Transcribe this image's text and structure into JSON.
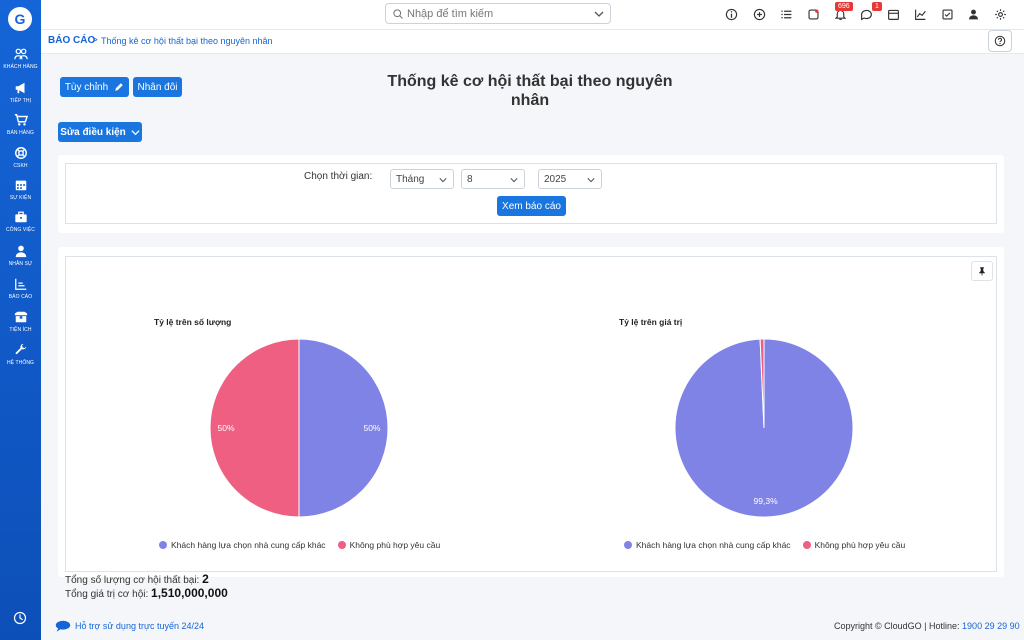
{
  "sidebar": {
    "logo": "G",
    "items": [
      {
        "label": "KHÁCH HÀNG",
        "icon": "users-icon"
      },
      {
        "label": "TIẾP THỊ",
        "icon": "megaphone-icon"
      },
      {
        "label": "BÁN HÀNG",
        "icon": "cart-icon"
      },
      {
        "label": "CSKH",
        "icon": "lifebuoy-icon"
      },
      {
        "label": "SỰ KIỆN",
        "icon": "calendar-icon"
      },
      {
        "label": "CÔNG VIỆC",
        "icon": "briefcase-icon"
      },
      {
        "label": "NHÂN SỰ",
        "icon": "person-icon"
      },
      {
        "label": "BÁO CÁO",
        "icon": "report-icon"
      },
      {
        "label": "TIỆN ÍCH",
        "icon": "box-icon"
      },
      {
        "label": "HỆ THỐNG",
        "icon": "wrench-icon"
      }
    ]
  },
  "topbar": {
    "search_placeholder": "Nhập để tìm kiếm",
    "notification_count": "696",
    "message_count": "1"
  },
  "breadcrumb": {
    "root": "BÁO CÁO",
    "separator": ">",
    "current": "Thống kê cơ hội thất bại theo nguyên nhân"
  },
  "toolbar": {
    "customize_label": "Tùy chỉnh",
    "duplicate_label": "Nhân đôi",
    "edit_conditions_label": "Sửa điều kiện"
  },
  "page": {
    "title_line1": "Thống kê cơ hội thất bại theo nguyên",
    "title_line2": "nhân"
  },
  "filter": {
    "label": "Chọn thời gian:",
    "period": "Tháng",
    "month": "8",
    "year": "2025",
    "submit_label": "Xem báo cáo"
  },
  "chart_data": [
    {
      "type": "pie",
      "title": "Tỷ lệ trên số lượng",
      "categories": [
        "Khách hàng lựa chọn nhà cung cấp khác",
        "Không phù hợp yêu cầu"
      ],
      "values": [
        50,
        50
      ],
      "labels": [
        "50%",
        "50%"
      ],
      "colors": [
        "#8083e6",
        "#ee5f82"
      ],
      "legend": "bottom"
    },
    {
      "type": "pie",
      "title": "Tỷ lệ trên giá trị",
      "categories": [
        "Khách hàng lựa chọn nhà cung cấp khác",
        "Không phù hợp yêu cầu"
      ],
      "values": [
        99.3,
        0.7
      ],
      "labels": [
        "99,3%",
        ""
      ],
      "colors": [
        "#8083e6",
        "#ee5f82"
      ],
      "legend": "bottom"
    }
  ],
  "summary": {
    "count_label": "Tổng số lượng cơ hội thất bại:",
    "count_value": "2",
    "value_label": "Tổng giá trị cơ hội:",
    "value_value": "1,510,000,000"
  },
  "footer": {
    "support": "Hỗ trợ sử dụng trực tuyến 24/24",
    "copyright": "Copyright © CloudGO",
    "hotline_label": "Hotline:",
    "hotline": "1900 29 29 90"
  },
  "colors": {
    "primary": "#1976e0",
    "sidebar": "#1565d8"
  }
}
